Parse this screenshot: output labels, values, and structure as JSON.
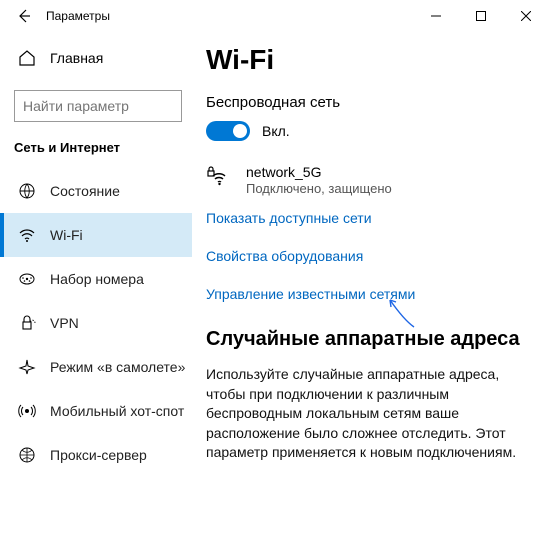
{
  "titlebar": {
    "title": "Параметры"
  },
  "sidebar": {
    "home": "Главная",
    "search_placeholder": "Найти параметр",
    "heading": "Сеть и Интернет",
    "items": [
      {
        "label": "Состояние"
      },
      {
        "label": "Wi-Fi"
      },
      {
        "label": "Набор номера"
      },
      {
        "label": "VPN"
      },
      {
        "label": "Режим «в самолете»"
      },
      {
        "label": "Мобильный хот-спот"
      },
      {
        "label": "Прокси-сервер"
      }
    ]
  },
  "main": {
    "page_title": "Wi-Fi",
    "wireless_label": "Беспроводная сеть",
    "toggle_state": "Вкл.",
    "network": {
      "name": "network_5G",
      "status": "Подключено, защищено"
    },
    "links": {
      "show_networks": "Показать доступные сети",
      "hardware_properties": "Свойства оборудования",
      "manage_known": "Управление известными сетями"
    },
    "random_addresses": {
      "title": "Случайные аппаратные адреса",
      "body": "Используйте случайные аппаратные адреса, чтобы при подключении к различным беспроводным локальным сетям ваше расположение было сложнее отследить. Этот параметр применяется к новым подключениям."
    }
  }
}
